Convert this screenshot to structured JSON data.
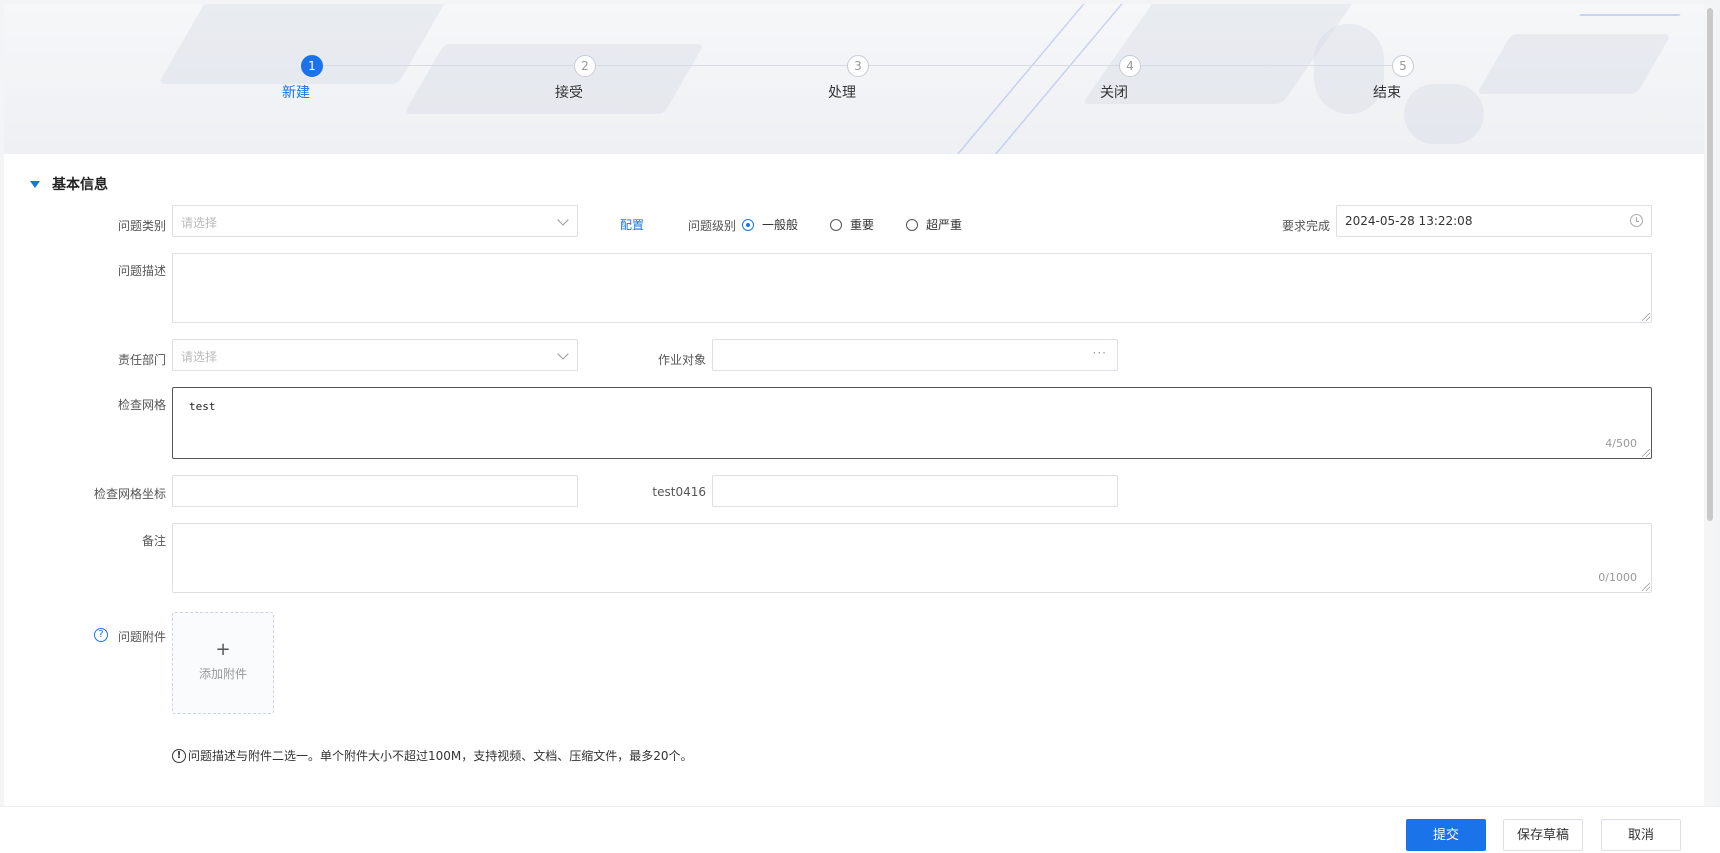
{
  "steps": [
    {
      "index": "1",
      "label": "新建",
      "active": true
    },
    {
      "index": "2",
      "label": "接受",
      "active": false
    },
    {
      "index": "3",
      "label": "处理",
      "active": false
    },
    {
      "index": "4",
      "label": "关闭",
      "active": false
    },
    {
      "index": "5",
      "label": "结束",
      "active": false
    }
  ],
  "section": {
    "title": "基本信息"
  },
  "form": {
    "category_label": "问题类别",
    "category_placeholder": "请选择",
    "config_link": "配置",
    "level_label": "问题级别",
    "levels": [
      "一般般",
      "重要",
      "超严重"
    ],
    "level_selected": "一般般",
    "deadline_label": "要求完成",
    "deadline_value": "2024-05-28 13:22:08",
    "description_label": "问题描述",
    "dept_label": "责任部门",
    "dept_placeholder": "请选择",
    "target_label": "作业对象",
    "target_button": "···",
    "grid_label": "检查网格",
    "grid_value": "test",
    "grid_counter": "4/500",
    "grid_coord_label": "检查网格坐标",
    "custom_label": "test0416",
    "remark_label": "备注",
    "remark_counter": "0/1000",
    "attachment_label": "问题附件",
    "attachment_help": "?",
    "upload_plus": "+",
    "upload_text": "添加附件",
    "notice_icon": "!",
    "notice_text": "问题描述与附件二选一。单个附件大小不超过100M，支持视频、文档、压缩文件，最多20个。"
  },
  "footer": {
    "submit": "提交",
    "save_draft": "保存草稿",
    "cancel": "取消"
  },
  "colors": {
    "accent": "#1a73e8"
  }
}
